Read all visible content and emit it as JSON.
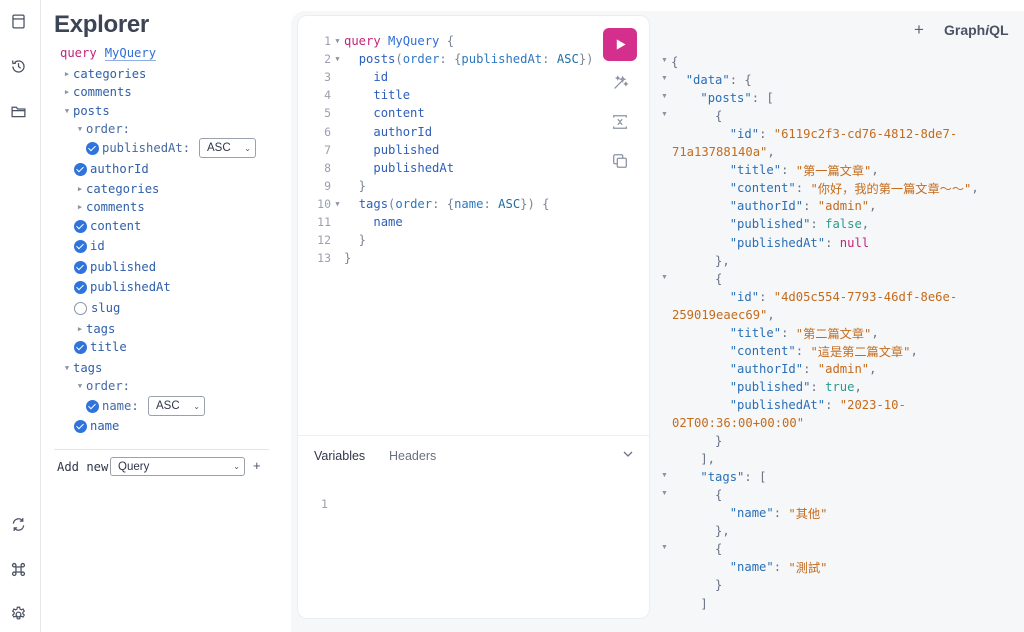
{
  "rail": {
    "icons": [
      "docs-icon",
      "history-icon",
      "folder-icon",
      "refetch-icon",
      "shortcut-icon",
      "settings-icon"
    ]
  },
  "explorer": {
    "title": "Explorer",
    "operation_keyword": "query",
    "operation_name": "MyQuery",
    "tree": [
      {
        "label": "categories",
        "state": "collapsed"
      },
      {
        "label": "comments",
        "state": "collapsed"
      },
      {
        "label": "posts",
        "state": "expanded"
      },
      {
        "label": "order:",
        "state": "expanded"
      },
      {
        "label": "publishedAt:",
        "state": "checked",
        "select": "ASC"
      },
      {
        "label": "authorId",
        "state": "checked"
      },
      {
        "label": "categories",
        "state": "collapsed"
      },
      {
        "label": "comments",
        "state": "collapsed"
      },
      {
        "label": "content",
        "state": "checked"
      },
      {
        "label": "id",
        "state": "checked"
      },
      {
        "label": "published",
        "state": "checked"
      },
      {
        "label": "publishedAt",
        "state": "checked"
      },
      {
        "label": "slug",
        "state": "unchecked"
      },
      {
        "label": "tags",
        "state": "collapsed"
      },
      {
        "label": "title",
        "state": "checked"
      },
      {
        "label": "tags",
        "state": "expanded"
      },
      {
        "label": "order:",
        "state": "expanded"
      },
      {
        "label": "name:",
        "state": "checked",
        "select": "ASC"
      },
      {
        "label": "name",
        "state": "checked"
      }
    ],
    "add_new_label": "Add new",
    "add_new_type": "Query",
    "add_new_plus": "+"
  },
  "editor": {
    "lines": [
      {
        "n": "1",
        "fold": true,
        "tokens": [
          [
            "kw",
            "query"
          ],
          [
            "p",
            " "
          ],
          [
            "def",
            "MyQuery"
          ],
          [
            "punc",
            " {"
          ]
        ]
      },
      {
        "n": "2",
        "fold": true,
        "tokens": [
          [
            "p",
            "  "
          ],
          [
            "fld",
            "posts"
          ],
          [
            "punc",
            "("
          ],
          [
            "arg",
            "order"
          ],
          [
            "punc",
            ": {"
          ],
          [
            "arg",
            "publishedAt"
          ],
          [
            "punc",
            ": "
          ],
          [
            "enum",
            "ASC"
          ],
          [
            "punc",
            "})"
          ]
        ]
      },
      {
        "n": "3",
        "fold": false,
        "tokens": [
          [
            "p",
            "    "
          ],
          [
            "fld",
            "id"
          ]
        ]
      },
      {
        "n": "4",
        "fold": false,
        "tokens": [
          [
            "p",
            "    "
          ],
          [
            "fld",
            "title"
          ]
        ]
      },
      {
        "n": "5",
        "fold": false,
        "tokens": [
          [
            "p",
            "    "
          ],
          [
            "fld",
            "content"
          ]
        ]
      },
      {
        "n": "6",
        "fold": false,
        "tokens": [
          [
            "p",
            "    "
          ],
          [
            "fld",
            "authorId"
          ]
        ]
      },
      {
        "n": "7",
        "fold": false,
        "tokens": [
          [
            "p",
            "    "
          ],
          [
            "fld",
            "published"
          ]
        ]
      },
      {
        "n": "8",
        "fold": false,
        "tokens": [
          [
            "p",
            "    "
          ],
          [
            "fld",
            "publishedAt"
          ]
        ]
      },
      {
        "n": "9",
        "fold": false,
        "tokens": [
          [
            "punc",
            "  }"
          ]
        ]
      },
      {
        "n": "10",
        "fold": true,
        "tokens": [
          [
            "p",
            "  "
          ],
          [
            "fld",
            "tags"
          ],
          [
            "punc",
            "("
          ],
          [
            "arg",
            "order"
          ],
          [
            "punc",
            ": {"
          ],
          [
            "arg",
            "name"
          ],
          [
            "punc",
            ": "
          ],
          [
            "enum",
            "ASC"
          ],
          [
            "punc",
            "}) {"
          ]
        ]
      },
      {
        "n": "11",
        "fold": false,
        "tokens": [
          [
            "p",
            "    "
          ],
          [
            "fld",
            "name"
          ]
        ]
      },
      {
        "n": "12",
        "fold": false,
        "tokens": [
          [
            "punc",
            "  }"
          ]
        ]
      },
      {
        "n": "13",
        "fold": false,
        "tokens": [
          [
            "punc",
            "}"
          ]
        ]
      }
    ],
    "variables_tab": "Variables",
    "headers_tab": "Headers",
    "variables_line": "1"
  },
  "result": {
    "plus": "+",
    "brand_main": "Graph",
    "brand_italic": "i",
    "brand_tail": "QL",
    "lines": [
      {
        "fold": true,
        "tokens": [
          [
            "jp",
            "{"
          ]
        ]
      },
      {
        "fold": true,
        "tokens": [
          [
            "jp",
            "  "
          ],
          [
            "jkey",
            "\"data\""
          ],
          [
            "jp",
            ": {"
          ]
        ]
      },
      {
        "fold": true,
        "tokens": [
          [
            "jp",
            "    "
          ],
          [
            "jkey",
            "\"posts\""
          ],
          [
            "jp",
            ": ["
          ]
        ]
      },
      {
        "fold": true,
        "tokens": [
          [
            "jp",
            "      {"
          ]
        ]
      },
      {
        "fold": false,
        "tokens": [
          [
            "jp",
            "        "
          ],
          [
            "jkey",
            "\"id\""
          ],
          [
            "jp",
            ": "
          ],
          [
            "jstr",
            "\"6119c2f3-cd76-4812-8de7-"
          ]
        ]
      },
      {
        "fold": false,
        "tokens": [
          [
            "jstr",
            "71a13788140a\""
          ],
          [
            "jp",
            ","
          ]
        ]
      },
      {
        "fold": false,
        "tokens": [
          [
            "jp",
            "        "
          ],
          [
            "jkey",
            "\"title\""
          ],
          [
            "jp",
            ": "
          ],
          [
            "jstr",
            "\"第一篇文章\""
          ],
          [
            "jp",
            ","
          ]
        ]
      },
      {
        "fold": false,
        "tokens": [
          [
            "jp",
            "        "
          ],
          [
            "jkey",
            "\"content\""
          ],
          [
            "jp",
            ": "
          ],
          [
            "jstr",
            "\"你好，我的第一篇文章～～\""
          ],
          [
            "jp",
            ","
          ]
        ]
      },
      {
        "fold": false,
        "tokens": [
          [
            "jp",
            "        "
          ],
          [
            "jkey",
            "\"authorId\""
          ],
          [
            "jp",
            ": "
          ],
          [
            "jstr",
            "\"admin\""
          ],
          [
            "jp",
            ","
          ]
        ]
      },
      {
        "fold": false,
        "tokens": [
          [
            "jp",
            "        "
          ],
          [
            "jkey",
            "\"published\""
          ],
          [
            "jp",
            ": "
          ],
          [
            "jlit",
            "false"
          ],
          [
            "jp",
            ","
          ]
        ]
      },
      {
        "fold": false,
        "tokens": [
          [
            "jp",
            "        "
          ],
          [
            "jkey",
            "\"publishedAt\""
          ],
          [
            "jp",
            ": "
          ],
          [
            "jnull",
            "null"
          ]
        ]
      },
      {
        "fold": false,
        "tokens": [
          [
            "jp",
            "      },"
          ]
        ]
      },
      {
        "fold": true,
        "tokens": [
          [
            "jp",
            "      {"
          ]
        ]
      },
      {
        "fold": false,
        "tokens": [
          [
            "jp",
            "        "
          ],
          [
            "jkey",
            "\"id\""
          ],
          [
            "jp",
            ": "
          ],
          [
            "jstr",
            "\"4d05c554-7793-46df-8e6e-"
          ]
        ]
      },
      {
        "fold": false,
        "tokens": [
          [
            "jstr",
            "259019eaec69\""
          ],
          [
            "jp",
            ","
          ]
        ]
      },
      {
        "fold": false,
        "tokens": [
          [
            "jp",
            "        "
          ],
          [
            "jkey",
            "\"title\""
          ],
          [
            "jp",
            ": "
          ],
          [
            "jstr",
            "\"第二篇文章\""
          ],
          [
            "jp",
            ","
          ]
        ]
      },
      {
        "fold": false,
        "tokens": [
          [
            "jp",
            "        "
          ],
          [
            "jkey",
            "\"content\""
          ],
          [
            "jp",
            ": "
          ],
          [
            "jstr",
            "\"這是第二篇文章\""
          ],
          [
            "jp",
            ","
          ]
        ]
      },
      {
        "fold": false,
        "tokens": [
          [
            "jp",
            "        "
          ],
          [
            "jkey",
            "\"authorId\""
          ],
          [
            "jp",
            ": "
          ],
          [
            "jstr",
            "\"admin\""
          ],
          [
            "jp",
            ","
          ]
        ]
      },
      {
        "fold": false,
        "tokens": [
          [
            "jp",
            "        "
          ],
          [
            "jkey",
            "\"published\""
          ],
          [
            "jp",
            ": "
          ],
          [
            "jlit",
            "true"
          ],
          [
            "jp",
            ","
          ]
        ]
      },
      {
        "fold": false,
        "tokens": [
          [
            "jp",
            "        "
          ],
          [
            "jkey",
            "\"publishedAt\""
          ],
          [
            "jp",
            ": "
          ],
          [
            "jstr",
            "\"2023-10-"
          ]
        ]
      },
      {
        "fold": false,
        "tokens": [
          [
            "jstr",
            "02T00:36:00+00:00\""
          ]
        ]
      },
      {
        "fold": false,
        "tokens": [
          [
            "jp",
            "      }"
          ]
        ]
      },
      {
        "fold": false,
        "tokens": [
          [
            "jp",
            "    ],"
          ]
        ]
      },
      {
        "fold": true,
        "tokens": [
          [
            "jp",
            "    "
          ],
          [
            "jkey",
            "\"tags\""
          ],
          [
            "jp",
            ": ["
          ]
        ]
      },
      {
        "fold": true,
        "tokens": [
          [
            "jp",
            "      {"
          ]
        ]
      },
      {
        "fold": false,
        "tokens": [
          [
            "jp",
            "        "
          ],
          [
            "jkey",
            "\"name\""
          ],
          [
            "jp",
            ": "
          ],
          [
            "jstr",
            "\"其他\""
          ]
        ]
      },
      {
        "fold": false,
        "tokens": [
          [
            "jp",
            "      },"
          ]
        ]
      },
      {
        "fold": true,
        "tokens": [
          [
            "jp",
            "      {"
          ]
        ]
      },
      {
        "fold": false,
        "tokens": [
          [
            "jp",
            "        "
          ],
          [
            "jkey",
            "\"name\""
          ],
          [
            "jp",
            ": "
          ],
          [
            "jstr",
            "\"測試\""
          ]
        ]
      },
      {
        "fold": false,
        "tokens": [
          [
            "jp",
            "      }"
          ]
        ]
      },
      {
        "fold": false,
        "tokens": [
          [
            "jp",
            "    ]"
          ]
        ]
      }
    ]
  }
}
